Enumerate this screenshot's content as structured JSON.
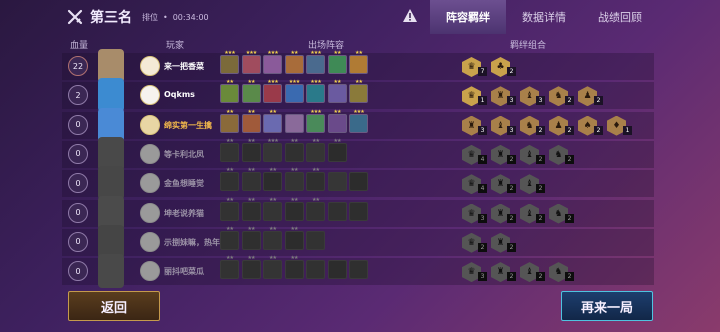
{
  "header": {
    "rank_icon": "crossed-swords-icon",
    "rank_title": "第三名",
    "rank_label": "排位",
    "dot": "•",
    "duration": "00:34:00",
    "warning_icon": "warning-icon"
  },
  "tabs": [
    {
      "label": "阵容羁绊",
      "active": true
    },
    {
      "label": "数据详情",
      "active": false
    },
    {
      "label": "战绩回顾",
      "active": false
    }
  ],
  "columns": {
    "hp": "血量",
    "player": "玩家",
    "lineup": "出场阵容",
    "traits": "羁绊组合"
  },
  "players": [
    {
      "hp": "22",
      "name": "来一把香菜",
      "name_color": "white",
      "dim": false,
      "avatar": "#a88c6a",
      "icon": "#f4ead6",
      "units": [
        [
          "#7b6a3a",
          3
        ],
        [
          "#a04c5e",
          3
        ],
        [
          "#8a5a9a",
          3
        ],
        [
          "#a86c3a",
          2
        ],
        [
          "#4a6a8e",
          3
        ],
        [
          "#3f8a56",
          2
        ],
        [
          "#b07b34",
          2
        ]
      ],
      "traits": [
        {
          "c": "#c9a24c",
          "n": "7",
          "g": "♛"
        },
        {
          "c": "#c9a24c",
          "n": "2",
          "g": "♣"
        }
      ]
    },
    {
      "hp": "2",
      "name": "Oqkms",
      "name_color": "white",
      "dim": false,
      "avatar": "#3c8bd1",
      "icon": "#f6f3ee",
      "units": [
        [
          "#6a8a3a",
          2
        ],
        [
          "#5a8a4a",
          2
        ],
        [
          "#9a3a4a",
          3
        ],
        [
          "#3a6ab0",
          3
        ],
        [
          "#2a7a8a",
          3
        ],
        [
          "#6a5aa0",
          2
        ],
        [
          "#8a7a3a",
          2
        ]
      ],
      "traits": [
        {
          "c": "#c9a24c",
          "n": "1",
          "g": "♛"
        },
        {
          "c": "#a8804a",
          "n": "3",
          "g": "♜"
        },
        {
          "c": "#a8804a",
          "n": "3",
          "g": "♝"
        },
        {
          "c": "#a8804a",
          "n": "2",
          "g": "♞"
        },
        {
          "c": "#a8804a",
          "n": "2",
          "g": "♟"
        }
      ]
    },
    {
      "hp": "0",
      "name": "绵实第一生擒",
      "name_color": "gold",
      "dim": false,
      "avatar": "#4a8ad6",
      "icon": "#e8d6a4",
      "units": [
        [
          "#8a6a3a",
          2
        ],
        [
          "#a05a3a",
          2
        ],
        [
          "#6a6ab0",
          2
        ],
        [
          "#8a6a9a",
          0
        ],
        [
          "#4a8a5a",
          3
        ],
        [
          "#6a4a8a",
          2
        ],
        [
          "#3a6a8a",
          3
        ]
      ],
      "traits": [
        {
          "c": "#a8804a",
          "n": "3",
          "g": "♜"
        },
        {
          "c": "#a8804a",
          "n": "3",
          "g": "♝"
        },
        {
          "c": "#a8804a",
          "n": "2",
          "g": "♞"
        },
        {
          "c": "#a8804a",
          "n": "2",
          "g": "♟"
        },
        {
          "c": "#a8804a",
          "n": "2",
          "g": "♠"
        },
        {
          "c": "#a8804a",
          "n": "1",
          "g": "♦"
        }
      ]
    },
    {
      "hp": "0",
      "name": "等卡利北凤",
      "name_color": "gray",
      "dim": true,
      "avatar": "#7a7a7a",
      "icon": "#9a9a9a",
      "units": [
        [
          "#555",
          2
        ],
        [
          "#4d4d4d",
          2
        ],
        [
          "#5a5a5a",
          3
        ],
        [
          "#505050",
          2
        ],
        [
          "#585858",
          2
        ],
        [
          "#4a4a4a",
          2
        ]
      ],
      "traits": [
        {
          "c": "#8e8e8e",
          "n": "4",
          "g": "♛"
        },
        {
          "c": "#8e8e8e",
          "n": "2",
          "g": "♜"
        },
        {
          "c": "#8e8e8e",
          "n": "2",
          "g": "♝"
        },
        {
          "c": "#8e8e8e",
          "n": "2",
          "g": "♞"
        }
      ]
    },
    {
      "hp": "0",
      "name": "金鱼想睡觉",
      "name_color": "gray",
      "dim": true,
      "avatar": "#767676",
      "icon": "#9a9a9a",
      "units": [
        [
          "#525252",
          2
        ],
        [
          "#555",
          2
        ],
        [
          "#4a4a4a",
          2
        ],
        [
          "#565656",
          2
        ],
        [
          "#4e4e4e",
          2
        ],
        [
          "#5a5a5a",
          0
        ],
        [
          "#494949",
          0
        ]
      ],
      "traits": [
        {
          "c": "#8e8e8e",
          "n": "4",
          "g": "♛"
        },
        {
          "c": "#8e8e8e",
          "n": "2",
          "g": "♜"
        },
        {
          "c": "#8e8e8e",
          "n": "2",
          "g": "♝"
        }
      ]
    },
    {
      "hp": "0",
      "name": "坤老说养猫",
      "name_color": "gray",
      "dim": true,
      "avatar": "#7d7d7d",
      "icon": "#9a9a9a",
      "units": [
        [
          "#535353",
          2
        ],
        [
          "#4f4f4f",
          2
        ],
        [
          "#575757",
          2
        ],
        [
          "#4b4b4b",
          2
        ],
        [
          "#545454",
          2
        ],
        [
          "#505050",
          0
        ],
        [
          "#4d4d4d",
          0
        ]
      ],
      "traits": [
        {
          "c": "#8e8e8e",
          "n": "3",
          "g": "♛"
        },
        {
          "c": "#8e8e8e",
          "n": "2",
          "g": "♜"
        },
        {
          "c": "#8e8e8e",
          "n": "2",
          "g": "♝"
        },
        {
          "c": "#8e8e8e",
          "n": "2",
          "g": "♞"
        }
      ]
    },
    {
      "hp": "0",
      "name": "示捌妹嘛，热年",
      "name_color": "gray",
      "dim": true,
      "avatar": "#737373",
      "icon": "#9a9a9a",
      "units": [
        [
          "#525252",
          2
        ],
        [
          "#4e4e4e",
          2
        ],
        [
          "#565656",
          2
        ],
        [
          "#4a4a4a",
          2
        ],
        [
          "#535353",
          0
        ]
      ],
      "traits": [
        {
          "c": "#8e8e8e",
          "n": "2",
          "g": "♛"
        },
        {
          "c": "#8e8e8e",
          "n": "2",
          "g": "♜"
        }
      ]
    },
    {
      "hp": "0",
      "name": "丽抖吧菜瓜",
      "name_color": "gray",
      "dim": true,
      "avatar": "#7a7a7a",
      "icon": "#9a9a9a",
      "units": [
        [
          "#545454",
          2
        ],
        [
          "#4f4f4f",
          2
        ],
        [
          "#575757",
          2
        ],
        [
          "#4c4c4c",
          2
        ],
        [
          "#525252",
          0
        ],
        [
          "#4a4a4a",
          0
        ],
        [
          "#4e4e4e",
          0
        ]
      ],
      "traits": [
        {
          "c": "#8e8e8e",
          "n": "3",
          "g": "♛"
        },
        {
          "c": "#8e8e8e",
          "n": "2",
          "g": "♜"
        },
        {
          "c": "#8e8e8e",
          "n": "2",
          "g": "♝"
        },
        {
          "c": "#8e8e8e",
          "n": "2",
          "g": "♞"
        }
      ]
    }
  ],
  "buttons": {
    "back": "返回",
    "again": "再来一局"
  }
}
